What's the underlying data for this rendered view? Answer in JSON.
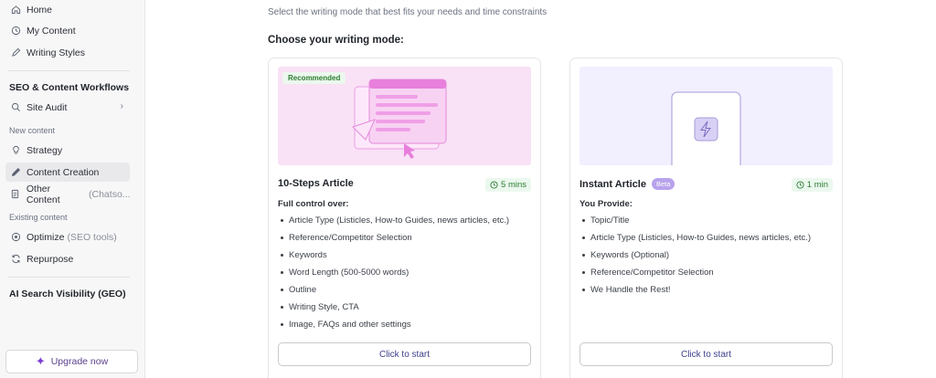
{
  "sidebar": {
    "top_items": [
      {
        "label": "Home",
        "icon": "home-icon"
      },
      {
        "label": "My Content",
        "icon": "history-icon"
      },
      {
        "label": "Writing Styles",
        "icon": "pen-icon"
      }
    ],
    "seo_section_title": "SEO & Content Workflows",
    "site_audit": {
      "label": "Site Audit",
      "icon": "search-icon"
    },
    "new_content_label": "New content",
    "strategy": {
      "label": "Strategy",
      "icon": "lightbulb-icon"
    },
    "content_creation": {
      "label": "Content Creation",
      "icon": "pencil-icon"
    },
    "other_content": {
      "label": "Other Content",
      "muted": "(Chatso..."
    },
    "existing_content_label": "Existing content",
    "optimize": {
      "label": "Optimize",
      "muted": "(SEO tools)"
    },
    "repurpose": {
      "label": "Repurpose"
    },
    "geo_section_title": "AI Search Visibility (GEO)",
    "upgrade_label": "Upgrade now"
  },
  "main": {
    "subtitle": "Select the writing mode that best fits your needs and time constraints",
    "heading": "Choose your writing mode:",
    "cards": [
      {
        "badge": "Recommended",
        "title": "10-Steps Article",
        "time": "5 mins",
        "list_title": "Full control over:",
        "items": [
          "Article Type (Listicles, How-to Guides, news articles, etc.)",
          "Reference/Competitor Selection",
          "Keywords",
          "Word Length (500-5000 words)",
          "Outline",
          "Writing Style, CTA",
          "Image, FAQs and other settings"
        ],
        "button": "Click to start"
      },
      {
        "title": "Instant Article",
        "beta": "Beta",
        "time": "1 min",
        "list_title": "You Provide:",
        "items": [
          "Topic/Title",
          "Article Type (Listicles, How-to Guides, news articles, etc.)",
          "Keywords (Optional)",
          "Reference/Competitor Selection",
          "We Handle the Rest!"
        ],
        "button": "Click to start"
      }
    ]
  },
  "colors": {
    "accent_green": "#2e7d32",
    "card1_illustration_bg": "#f9e1f6",
    "card2_illustration_bg": "#f2efff",
    "upgrade_purple": "#7a3fd1"
  }
}
